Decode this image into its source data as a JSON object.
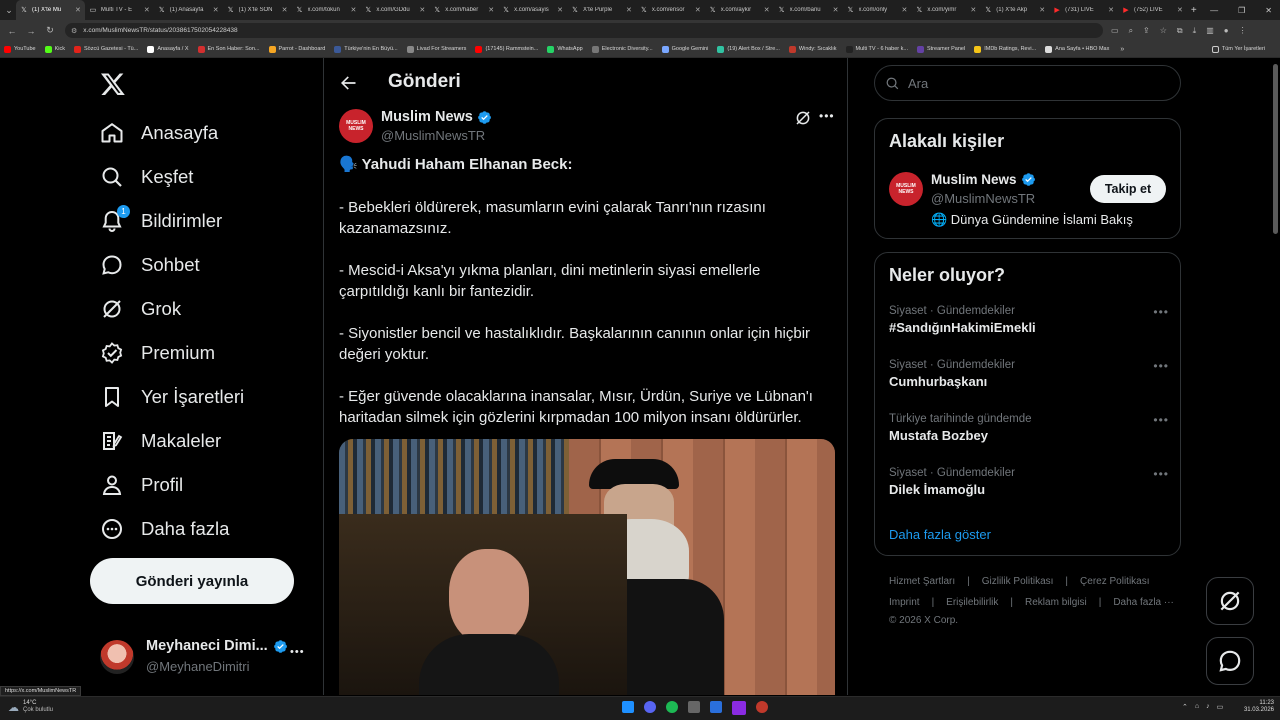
{
  "browser": {
    "tabs": [
      {
        "title": "(1) X'te Mu",
        "active": true,
        "icon": "x-icon"
      },
      {
        "title": "Multi TV - E",
        "icon": "tv-icon"
      },
      {
        "title": "(1) Anasayfa",
        "icon": "x-icon"
      },
      {
        "title": "(1) X'te SON",
        "icon": "x-icon"
      },
      {
        "title": "x.com/tokun",
        "icon": "x-icon"
      },
      {
        "title": "x.com/GDdu",
        "icon": "x-icon"
      },
      {
        "title": "x.com/haber",
        "icon": "x-icon"
      },
      {
        "title": "x.com/asayis",
        "icon": "x-icon"
      },
      {
        "title": "X'te Purple",
        "icon": "x-icon"
      },
      {
        "title": "x.com/ensor",
        "icon": "x-icon"
      },
      {
        "title": "x.com/aykir",
        "icon": "x-icon"
      },
      {
        "title": "x.com/banu",
        "icon": "x-icon"
      },
      {
        "title": "x.com/only",
        "icon": "x-icon"
      },
      {
        "title": "x.com/yimr",
        "icon": "x-icon"
      },
      {
        "title": "(1) X'te Akp",
        "icon": "x-icon"
      },
      {
        "title": "(731) LIVE",
        "icon": "youtube-icon"
      },
      {
        "title": "(752) LIVE",
        "icon": "youtube-icon"
      }
    ],
    "url": "x.com/MuslimNewsTR/status/2038617502054228438",
    "bookmarks": [
      {
        "label": "YouTube",
        "color": "#ff0000"
      },
      {
        "label": "Kick",
        "color": "#53fc18"
      },
      {
        "label": "Sözcü Gazetesi - Tü...",
        "color": "#e2231a"
      },
      {
        "label": "Anasayfa / X",
        "color": "#ffffff"
      },
      {
        "label": "En Son Haber: Son...",
        "color": "#d32f2f"
      },
      {
        "label": "Parrot - Dashboard",
        "color": "#f5a623"
      },
      {
        "label": "Türkiye'nin En Büyü...",
        "color": "#3b5998"
      },
      {
        "label": "Livad For Streamers",
        "color": "#888888"
      },
      {
        "label": "(17145) Rammstein...",
        "color": "#ff0000"
      },
      {
        "label": "WhatsApp",
        "color": "#25d366"
      },
      {
        "label": "Electronic Diversity...",
        "color": "#777777"
      },
      {
        "label": "Google Gemini",
        "color": "#7aa7ff"
      },
      {
        "label": "(19) Alert Box / Stre...",
        "color": "#31c3a2"
      },
      {
        "label": "Windy: Sıcaklık",
        "color": "#c0392b"
      },
      {
        "label": "Multi TV - 6 haber k...",
        "color": "#222222"
      },
      {
        "label": "Streamer Panel",
        "color": "#6441a5"
      },
      {
        "label": "IMDb Ratings, Revi...",
        "color": "#f5c518"
      },
      {
        "label": "Ana Sayfa • HBO Max",
        "color": "#dddddd"
      }
    ],
    "all_bookmarks_label": "Tüm Yer İşaretleri"
  },
  "nav": {
    "logo": "x-logo-icon",
    "items": [
      {
        "label": "Anasayfa",
        "icon": "home-icon"
      },
      {
        "label": "Keşfet",
        "icon": "search-icon"
      },
      {
        "label": "Bildirimler",
        "icon": "bell-icon",
        "badge": "1"
      },
      {
        "label": "Sohbet",
        "icon": "chat-icon"
      },
      {
        "label": "Grok",
        "icon": "grok-icon"
      },
      {
        "label": "Premium",
        "icon": "premium-icon"
      },
      {
        "label": "Yer İşaretleri",
        "icon": "bookmark-icon"
      },
      {
        "label": "Makaleler",
        "icon": "articles-icon"
      },
      {
        "label": "Profil",
        "icon": "profile-icon"
      },
      {
        "label": "Daha fazla",
        "icon": "more-icon"
      }
    ],
    "post_button": "Gönderi yayınla",
    "account": {
      "name": "Meyhaneci Dimi...",
      "handle": "@MeyhaneDimitri",
      "more": "•••"
    }
  },
  "post": {
    "header_title": "Gönderi",
    "author_name": "Muslim News",
    "author_handle": "@MuslimNewsTR",
    "avatar_text": "MUSLIM NEWS",
    "heading": "🗣️ Yahudi Haham Elhanan Beck:",
    "body": "- Bebekleri öldürerek, masumların evini çalarak Tanrı'nın rızasını kazanamazsınız.\n\n- Mescid-i Aksa'yı yıkma planları, dini metinlerin siyasi emellerle çarpıtıldığı kanlı bir fantezidir.\n\n- Siyonistler bencil ve hastalıklıdır. Başkalarının canının onlar için hiçbir değeri yoktur.\n\n- Eğer güvende olacaklarına inansalar, Mısır, Ürdün, Suriye ve Lübnan'ı haritadan silmek için gözlerini kırpmadan 100 milyon insanı öldürürler."
  },
  "right": {
    "search_placeholder": "Ara",
    "related_title": "Alakalı kişiler",
    "related": {
      "name": "Muslim News",
      "handle": "@MuslimNewsTR",
      "bio": "🌐 Dünya Gündemine İslami Bakış",
      "follow": "Takip et"
    },
    "trends_title": "Neler oluyor?",
    "trends": [
      {
        "category": "Siyaset · Gündemdekiler",
        "name": "#SandığınHakimiEmekli"
      },
      {
        "category": "Siyaset · Gündemdekiler",
        "name": "Cumhurbaşkanı"
      },
      {
        "category": "Türkiye tarihinde gündemde",
        "name": "Mustafa Bozbey"
      },
      {
        "category": "Siyaset · Gündemdekiler",
        "name": "Dilek İmamoğlu"
      }
    ],
    "show_more": "Daha fazla göster",
    "footer_row1": [
      "Hizmet Şartları",
      "Gizlilik Politikası",
      "Çerez Politikası"
    ],
    "footer_row2": [
      "Imprint",
      "Erişilebilirlik",
      "Reklam bilgisi",
      "Daha fazla ···"
    ],
    "copyright": "© 2026 X Corp."
  },
  "status_url": "https://x.com/MuslimNewsTR",
  "taskbar": {
    "weather_temp": "14°C",
    "weather_desc": "Çok bulutlu",
    "time": "11:23",
    "date": "31.03.2026"
  },
  "colors": {
    "accent": "#1d9bf0",
    "background": "#000000",
    "border": "#2f3336"
  }
}
